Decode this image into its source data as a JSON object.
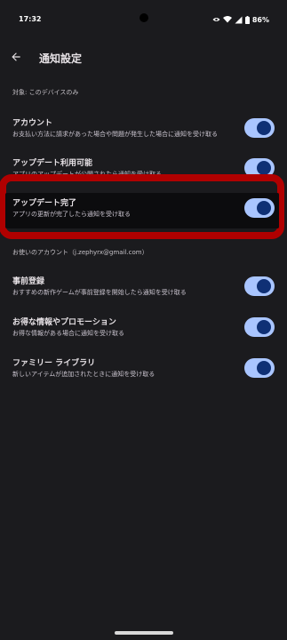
{
  "status_bar": {
    "time": "17:32",
    "battery_percent": "86%",
    "icons": [
      "eye-icon",
      "wifi-icon",
      "signal-icon",
      "battery-icon"
    ]
  },
  "app_bar": {
    "title": "通知設定",
    "back_icon": "arrow-back-icon"
  },
  "sections": [
    {
      "label": "対象: このデバイスのみ",
      "items": [
        {
          "title": "アカウント",
          "subtitle": "お支払い方法に請求があった場合や問題が発生した場合に通知を受け取る",
          "enabled": true
        },
        {
          "title": "アップデート利用可能",
          "subtitle": "アプリのアップデートが公開されたら通知を受け取る",
          "enabled": true
        },
        {
          "title": "アップデート完了",
          "subtitle": "アプリの更新が完了したら通知を受け取る",
          "enabled": true,
          "highlighted": true
        }
      ]
    },
    {
      "label": "お使いのアカウント（j.zephyrx@gmail.com）",
      "items": [
        {
          "title": "事前登録",
          "subtitle": "おすすめの新作ゲームが事前登録を開始したら通知を受け取る",
          "enabled": true
        },
        {
          "title": "お得な情報やプロモーション",
          "subtitle": "お得な情報がある場合に通知を受け取る",
          "enabled": true
        },
        {
          "title": "ファミリー ライブラリ",
          "subtitle": "新しいアイテムが追加されたときに通知を受け取る",
          "enabled": true
        }
      ]
    }
  ],
  "colors": {
    "background": "#1b1b1e",
    "switch_track_on": "#a9c5ff",
    "switch_thumb_on": "#0f3075",
    "highlight_border": "#b00000"
  }
}
